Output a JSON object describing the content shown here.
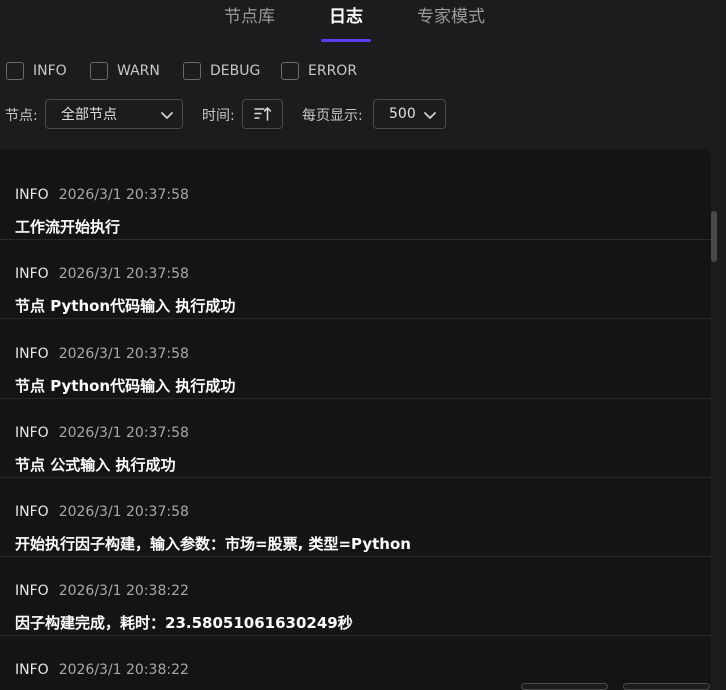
{
  "tabs": [
    {
      "label": "节点库",
      "active": false
    },
    {
      "label": "日志",
      "active": true
    },
    {
      "label": "专家模式",
      "active": false
    }
  ],
  "filters": {
    "levels": [
      {
        "label": "INFO",
        "checked": false
      },
      {
        "label": "WARN",
        "checked": false
      },
      {
        "label": "DEBUG",
        "checked": false
      },
      {
        "label": "ERROR",
        "checked": false
      }
    ],
    "node_label": "节点:",
    "node_value": "全部节点",
    "time_label": "时间:",
    "sort_icon": "sort-ascending-icon",
    "page_size_label": "每页显示:",
    "page_size_value": "500"
  },
  "logs": [
    {
      "level": "INFO",
      "time": "2026/3/1 20:37:58",
      "message": "工作流开始执行"
    },
    {
      "level": "INFO",
      "time": "2026/3/1 20:37:58",
      "message": "节点 Python代码输入 执行成功"
    },
    {
      "level": "INFO",
      "time": "2026/3/1 20:37:58",
      "message": "节点 Python代码输入 执行成功"
    },
    {
      "level": "INFO",
      "time": "2026/3/1 20:37:58",
      "message": "节点 公式输入 执行成功"
    },
    {
      "level": "INFO",
      "time": "2026/3/1 20:37:58",
      "message": "开始执行因子构建，输入参数：市场=股票, 类型=Python"
    },
    {
      "level": "INFO",
      "time": "2026/3/1 20:38:22",
      "message": "因子构建完成，耗时：23.58051061630249秒"
    },
    {
      "level": "INFO",
      "time": "2026/3/1 20:38:22",
      "message": ""
    }
  ],
  "colors": {
    "accent": "#5b3cf0",
    "background": "#1c1c1e",
    "panel": "#141414"
  }
}
